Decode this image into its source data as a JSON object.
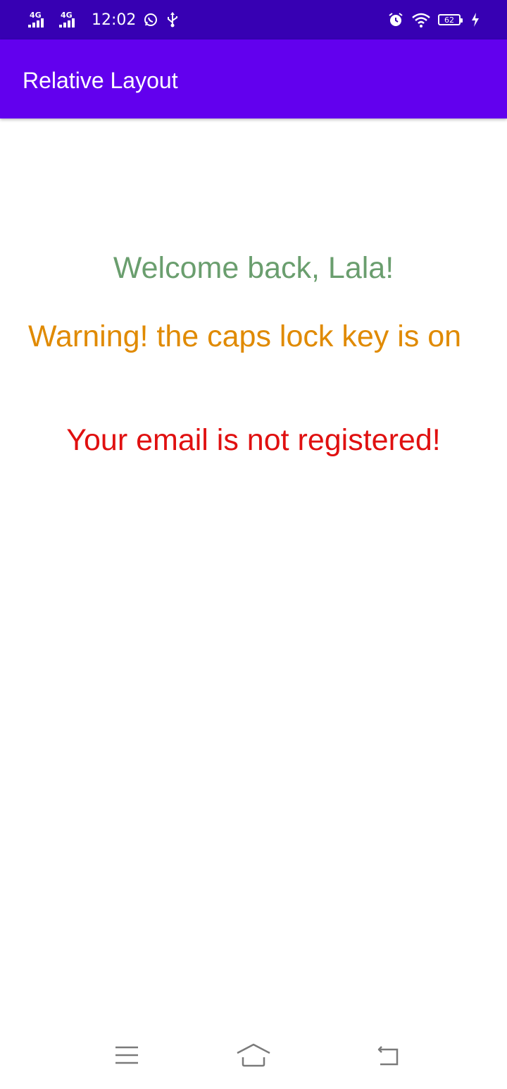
{
  "status_bar": {
    "network_1": "4G",
    "network_2": "4G",
    "time": "12:02",
    "battery": "62",
    "icons": [
      "signal-icon",
      "signal-icon",
      "whatsapp-icon",
      "usb-icon",
      "alarm-icon",
      "wifi-icon",
      "battery-icon",
      "charging-icon"
    ]
  },
  "app_bar": {
    "title": "Relative Layout"
  },
  "content": {
    "welcome": "Welcome back, Lala!",
    "warning": "Warning! the caps lock key is on",
    "error": "Your email is not registered!"
  },
  "nav_bar": {
    "icons": [
      "menu-icon",
      "home-icon",
      "back-icon"
    ]
  },
  "colors": {
    "status_bar": "#3700b3",
    "app_bar": "#6200ee",
    "welcome": "#6a9e6e",
    "warning": "#e08a00",
    "error": "#e01010",
    "nav_icon": "#7a7a7a"
  }
}
